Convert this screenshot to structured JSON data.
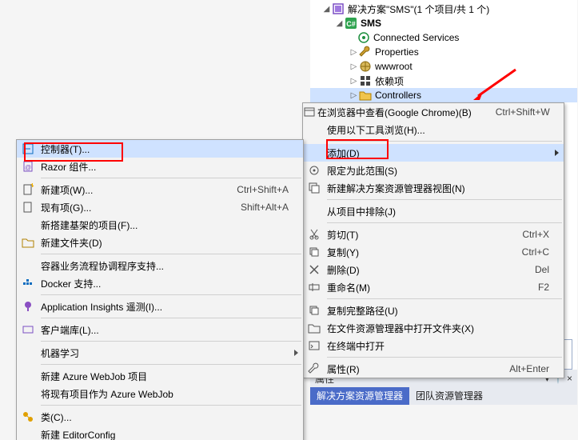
{
  "explorer": {
    "root": "解决方案\"SMS\"(1 个项目/共 1 个)",
    "project": "SMS",
    "items": {
      "connected_services": "Connected Services",
      "properties": "Properties",
      "wwwroot": "wwwroot",
      "dependencies": "依赖项",
      "controllers": "Controllers"
    },
    "props_title": "属性",
    "tabs": {
      "sol": "解决方案资源管理器",
      "team": "团队资源管理器"
    }
  },
  "context_menu": {
    "view_in_browser": "在浏览器中查看(Google Chrome)(B)",
    "view_in_browser_accel": "Ctrl+Shift+W",
    "browse_with": "使用以下工具浏览(H)...",
    "add": "添加(D)",
    "scope_to": "限定为此范围(S)",
    "new_view": "新建解决方案资源管理器视图(N)",
    "exclude": "从项目中排除(J)",
    "cut": "剪切(T)",
    "cut_accel": "Ctrl+X",
    "copy": "复制(Y)",
    "copy_accel": "Ctrl+C",
    "delete": "删除(D)",
    "delete_accel": "Del",
    "rename": "重命名(M)",
    "rename_accel": "F2",
    "copy_path": "复制完整路径(U)",
    "open_in_explorer": "在文件资源管理器中打开文件夹(X)",
    "open_in_terminal": "在终端中打开",
    "properties": "属性(R)",
    "properties_accel": "Alt+Enter"
  },
  "add_submenu": {
    "controller": "控制器(T)...",
    "razor_component": "Razor 组件...",
    "new_item": "新建项(W)...",
    "new_item_accel": "Ctrl+Shift+A",
    "existing_item": "现有项(G)...",
    "existing_item_accel": "Shift+Alt+A",
    "scaffolded_item": "新搭建基架的项目(F)...",
    "new_folder": "新建文件夹(D)",
    "container_orchestrator": "容器业务流程协调程序支持...",
    "docker_support": "Docker 支持...",
    "app_insights": "Application Insights 遥测(I)...",
    "client_library": "客户端库(L)...",
    "machine_learning": "机器学习",
    "new_azure_webjob": "新建 Azure WebJob 项目",
    "existing_azure_webjob": "将现有项目作为 Azure WebJob",
    "class": "类(C)...",
    "editorconfig": "新建 EditorConfig"
  }
}
